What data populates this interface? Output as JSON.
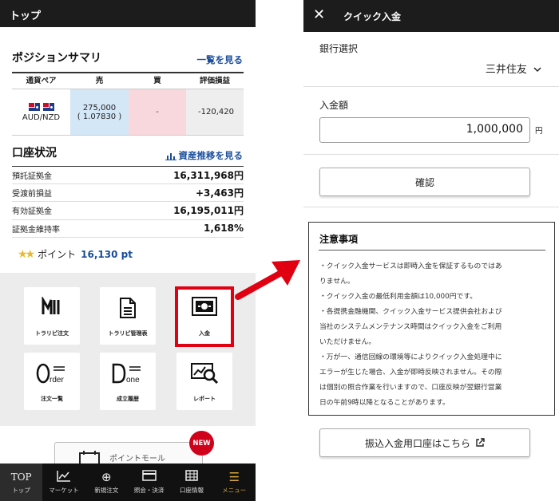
{
  "left": {
    "header_title": "トップ",
    "positions": {
      "title": "ポジションサマリ",
      "link": "一覧を見る",
      "columns": [
        "通貨ペア",
        "売",
        "買",
        "評価損益"
      ],
      "rows": [
        {
          "pair": "AUD/NZD",
          "sell_amount": "275,000",
          "sell_rate": "( 1.07830 )",
          "buy": "-",
          "pl": "-120,420"
        }
      ]
    },
    "account": {
      "title": "口座状況",
      "link": "資産推移を見る",
      "rows": [
        {
          "label": "預託証拠金",
          "value": "16,311,968円"
        },
        {
          "label": "受渡前損益",
          "value": "+3,463円"
        },
        {
          "label": "有効証拠金",
          "value": "16,195,011円"
        },
        {
          "label": "証拠金維持率",
          "value": "1,618%"
        }
      ]
    },
    "points": {
      "label": "ポイント",
      "value": "16,130 pt"
    },
    "tiles": [
      {
        "label": "トラリピ注文",
        "icon": "trarip-order-icon"
      },
      {
        "label": "トラリピ管理表",
        "icon": "document-icon"
      },
      {
        "label": "入金",
        "icon": "deposit-icon"
      },
      {
        "label": "注文一覧",
        "icon": "order-list-icon"
      },
      {
        "label": "成立履歴",
        "icon": "done-history-icon"
      },
      {
        "label": "レポート",
        "icon": "report-icon"
      }
    ],
    "promo": {
      "badge": "NEW",
      "text": "ポイントモール"
    },
    "nav": [
      {
        "icon": "TOP",
        "label": "トップ"
      },
      {
        "icon": "chart-icon",
        "label": "マーケット"
      },
      {
        "icon": "plus-circle-icon",
        "label": "新規注文"
      },
      {
        "icon": "card-icon",
        "label": "照会・決済"
      },
      {
        "icon": "table-icon",
        "label": "口座情報"
      },
      {
        "icon": "menu-icon",
        "label": "メニュー"
      }
    ]
  },
  "right": {
    "header_title": "クイック入金",
    "bank_label": "銀行選択",
    "bank_value": "三井住友",
    "amount_label": "入金額",
    "amount_value": "1,000,000",
    "amount_unit": "円",
    "confirm": "確認",
    "notice": {
      "title": "注意事項",
      "lines": [
        "・クイック入金サービスは即時入金を保証するものではあ",
        "りません。",
        "・クイック入金の最低利用金額は10,000円です。",
        "・各提携金融機関、クイック入金サービス提供会社および",
        "当社のシステムメンテナンス時間はクイック入金をご利用",
        "いただけません。",
        "・万が一、通信回線の環境等によりクイック入金処理中に",
        "エラーが生じた場合、入金が即時反映されません。その際",
        "は個別の照合作業を行いますので、口座反映が翌銀行営業",
        "日の午前9時以降となることがあります。"
      ]
    },
    "transfer_button": "振込入金用口座はこちら"
  },
  "colors": {
    "highlight": "#e00012",
    "link": "#1a4d9c",
    "sell_bg": "#d4e7f7",
    "buy_bg": "#f8d8dc"
  }
}
